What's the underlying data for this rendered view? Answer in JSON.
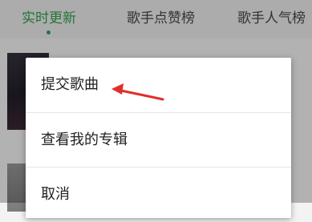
{
  "tabs": [
    {
      "label": "实时更新",
      "active": true
    },
    {
      "label": "歌手点赞榜",
      "active": false
    },
    {
      "label": "歌手人气榜",
      "active": false
    }
  ],
  "menu": {
    "items": [
      {
        "label": "提交歌曲"
      },
      {
        "label": "查看我的专辑"
      },
      {
        "label": "取消"
      }
    ]
  },
  "colors": {
    "accent": "#34a853",
    "annotation_arrow": "#e0302a",
    "overlay": "rgba(0,0,0,0.30)"
  }
}
